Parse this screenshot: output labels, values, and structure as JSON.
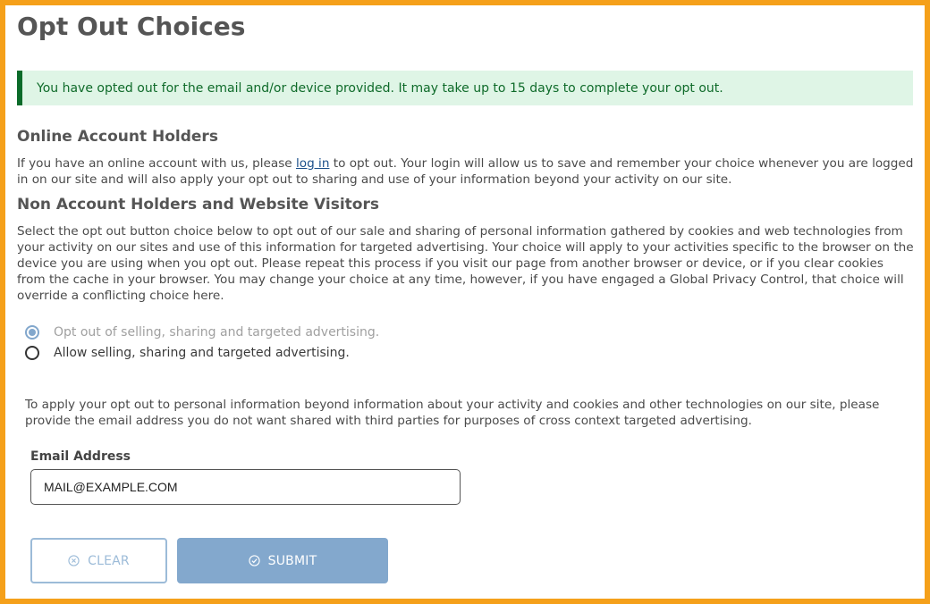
{
  "page": {
    "title": "Opt Out Choices"
  },
  "alert": {
    "message": "You have opted out for the email and/or device provided. It may take up to 15 days to complete your opt out.",
    "color": "#dff5e6",
    "accent": "#0b6b2a"
  },
  "online_section": {
    "heading": "Online Account Holders",
    "text_before_link": "If you have an online account with us, please ",
    "link_text": "log in",
    "text_after_link": " to opt out. Your login will allow us to save and remember your choice whenever you are logged in on our site and will also apply your opt out to sharing and use of your information beyond your activity on our site."
  },
  "visitor_section": {
    "heading": "Non Account Holders and Website Visitors",
    "text": "Select the opt out button choice below to opt out of our sale and sharing of personal information gathered by cookies and web technologies from your activity on our sites and use of this information for targeted advertising. Your choice will apply to your activities specific to the browser on the device you are using when you opt out. Please repeat this process if you visit our page from another browser or device, or if you clear cookies from the cache in your browser. You may change your choice at any time, however, if you have engaged a Global Privacy Control, that choice will override a conflicting choice here."
  },
  "choices": {
    "options": [
      {
        "label": "Opt out of selling, sharing and targeted advertising.",
        "selected": true,
        "disabled": true
      },
      {
        "label": "Allow selling, sharing and targeted advertising.",
        "selected": false,
        "disabled": false
      }
    ]
  },
  "email_section": {
    "text": "To apply your opt out to personal information beyond information about your activity and cookies and other technologies on our site, please provide the email address you do not want shared with third parties for purposes of cross context targeted advertising.",
    "label": "Email Address",
    "value": "MAIL@EXAMPLE.COM"
  },
  "buttons": {
    "clear_label": "CLEAR",
    "submit_label": "SUBMIT",
    "clear_icon": "circle-x-icon",
    "submit_icon": "circle-check-icon"
  },
  "colors": {
    "frame": "#f5a01a",
    "button_blue": "#83a8cd"
  }
}
